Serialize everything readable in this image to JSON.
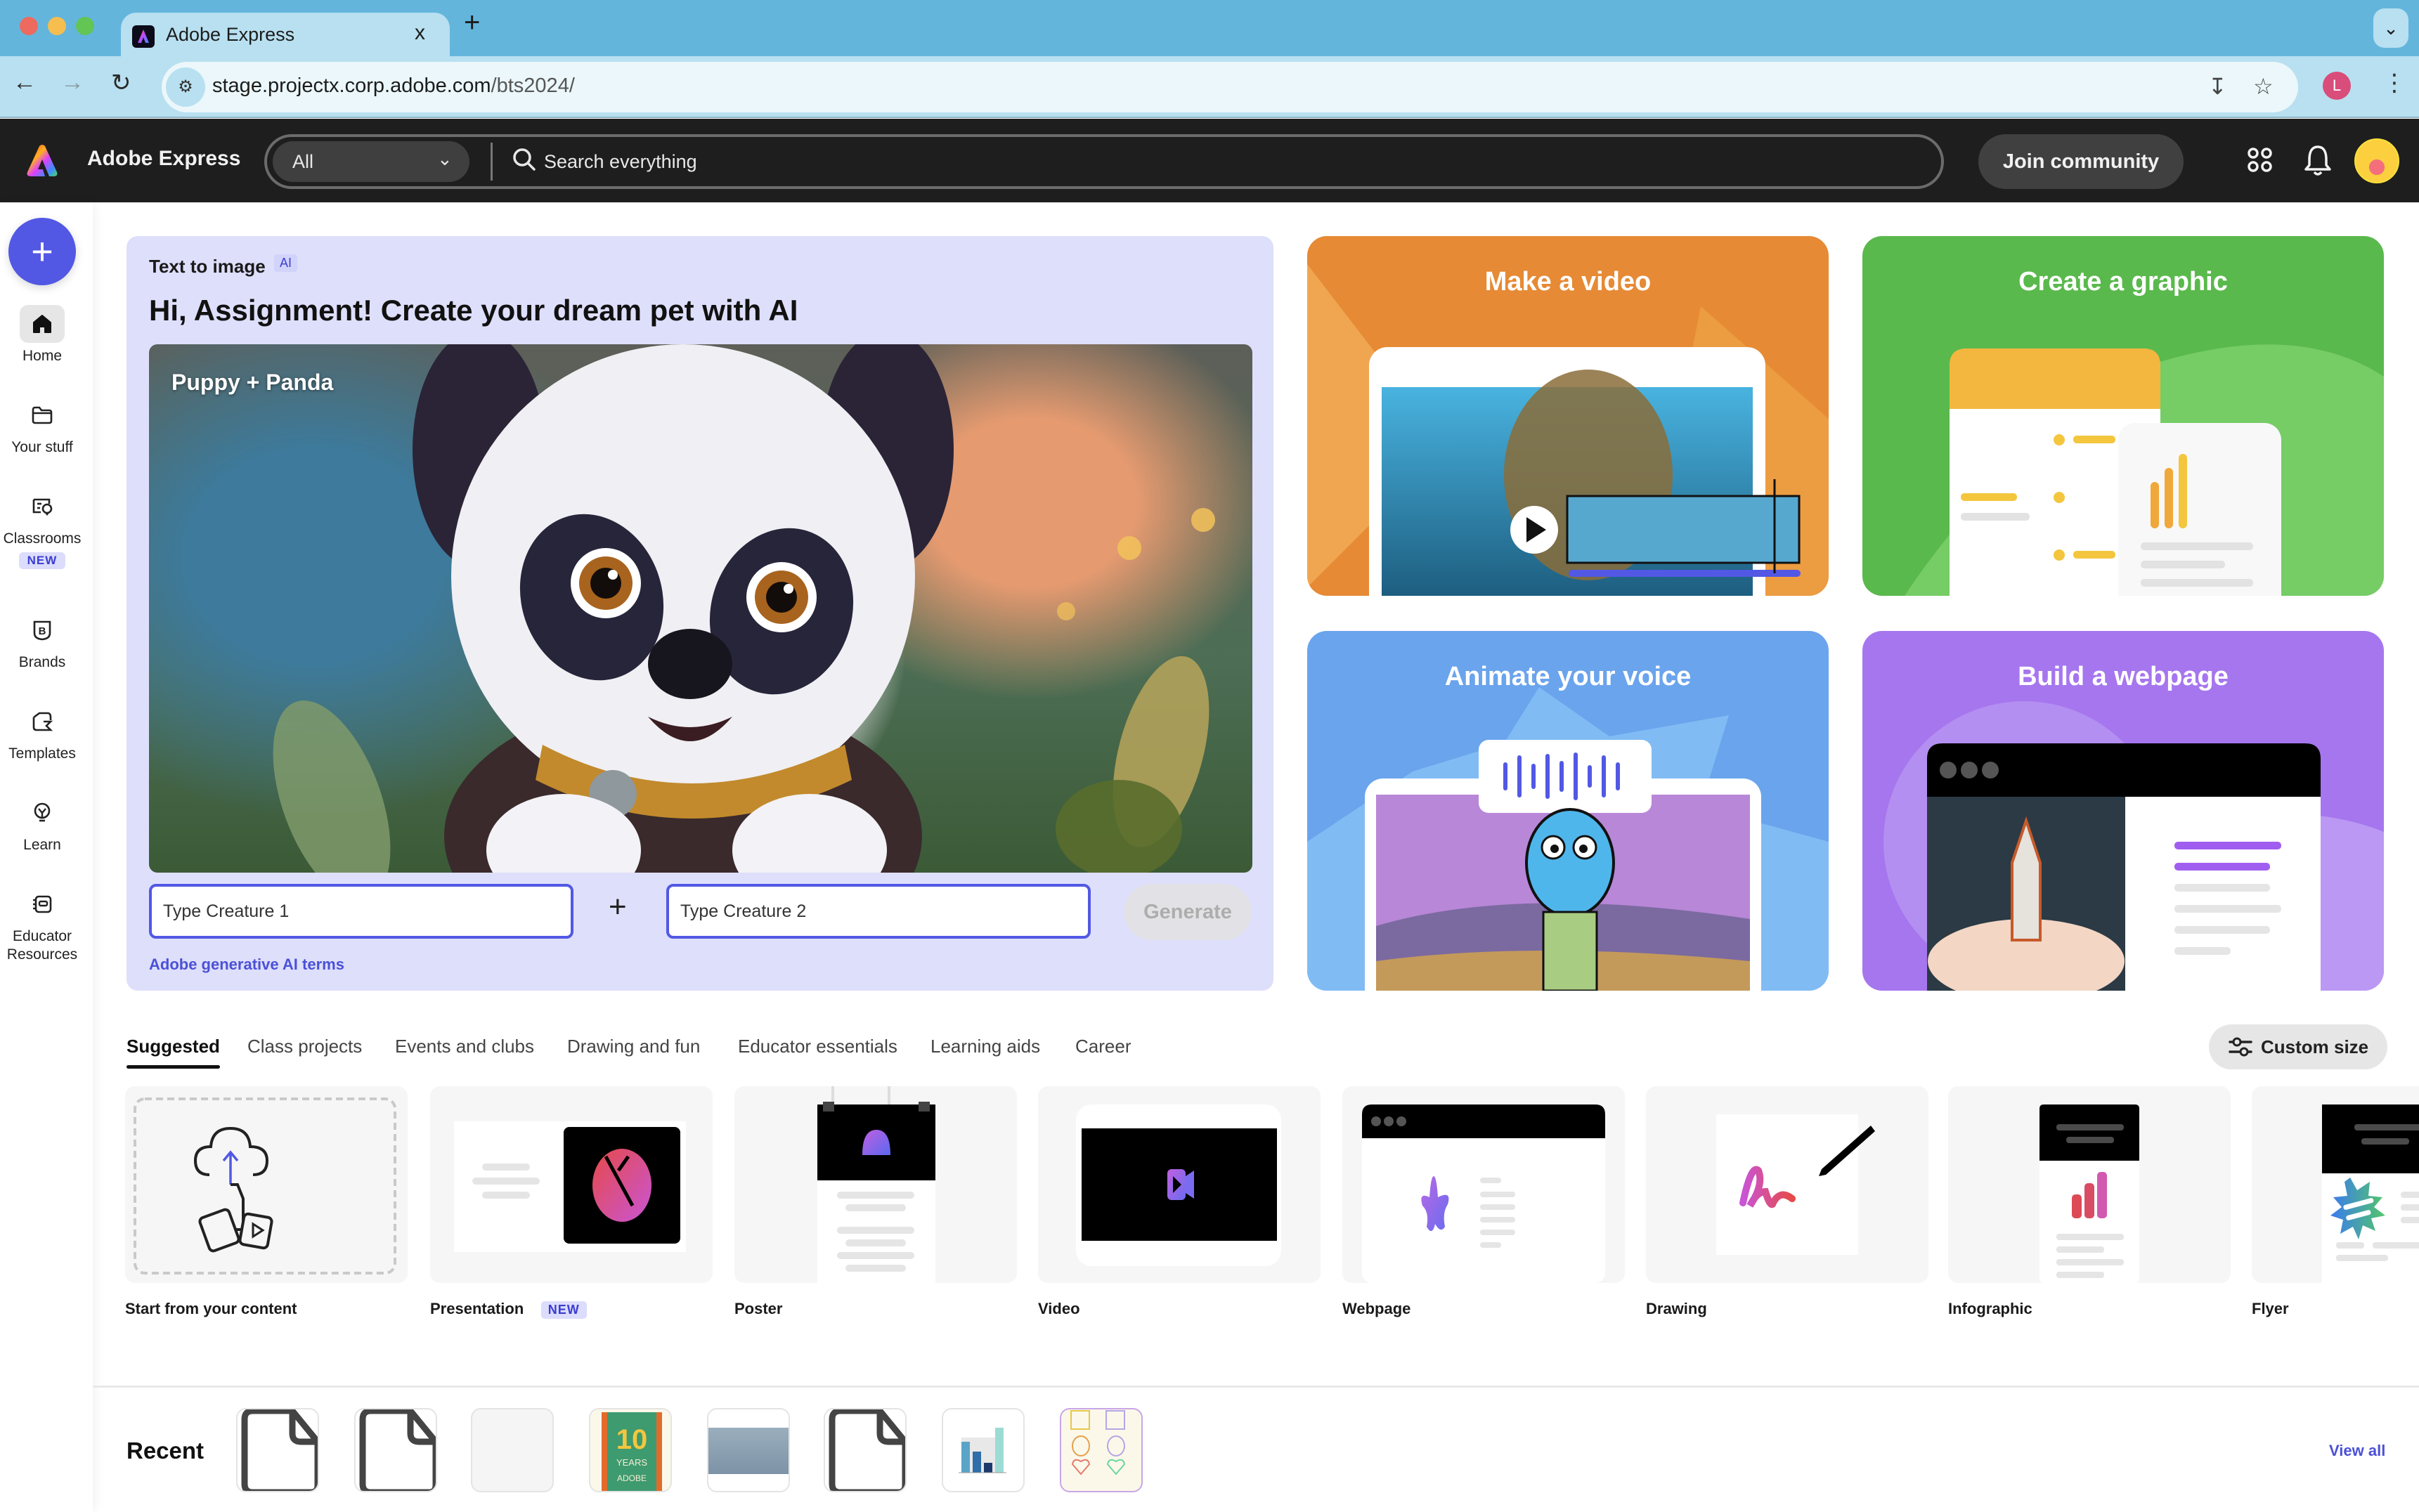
{
  "browser": {
    "tab_title": "Adobe Express",
    "tab_close": "x",
    "new_tab": "+",
    "url_host": "stage.projectx.corp.adobe.com",
    "url_path": "/bts2024/",
    "profile_initial": "L"
  },
  "header": {
    "app_name": "Adobe Express",
    "search_scope": "All",
    "search_placeholder": "Search everything",
    "join_label": "Join community"
  },
  "sidebar": {
    "create_label": "+",
    "items": [
      {
        "label": "Home",
        "icon": "home-icon",
        "active": true
      },
      {
        "label": "Your stuff",
        "icon": "folder-icon"
      },
      {
        "label": "Classrooms",
        "icon": "classroom-icon",
        "badge": "NEW"
      },
      {
        "label": "Brands",
        "icon": "brand-icon"
      },
      {
        "label": "Templates",
        "icon": "templates-icon"
      },
      {
        "label": "Learn",
        "icon": "lightbulb-icon"
      },
      {
        "label": "Educator Resources",
        "icon": "educator-resources-icon"
      }
    ]
  },
  "hero": {
    "eyebrow": "Text to image",
    "ai_badge": "AI",
    "title": "Hi, Assignment! Create your dream pet with AI",
    "image_caption": "Puppy + Panda",
    "creature1_placeholder": "Type Creature 1",
    "plus": "+",
    "creature2_placeholder": "Type Creature 2",
    "generate_label": "Generate",
    "terms_link": "Adobe generative AI terms"
  },
  "quick_actions": [
    {
      "title": "Make a video",
      "color": "#e68a35"
    },
    {
      "title": "Create a graphic",
      "color": "#5ab94c"
    },
    {
      "title": "Animate your voice",
      "color": "#6aa4ec"
    },
    {
      "title": "Build a webpage",
      "color": "#a676ee"
    }
  ],
  "category_tabs": [
    {
      "label": "Suggested",
      "active": true
    },
    {
      "label": "Class projects"
    },
    {
      "label": "Events and clubs"
    },
    {
      "label": "Drawing and fun"
    },
    {
      "label": "Educator essentials"
    },
    {
      "label": "Learning aids"
    },
    {
      "label": "Career"
    }
  ],
  "custom_size_label": "Custom size",
  "templates": [
    {
      "label": "Start from your content"
    },
    {
      "label": "Presentation",
      "badge": "NEW"
    },
    {
      "label": "Poster"
    },
    {
      "label": "Video"
    },
    {
      "label": "Webpage"
    },
    {
      "label": "Drawing"
    },
    {
      "label": "Infographic"
    },
    {
      "label": "Flyer"
    }
  ],
  "recent": {
    "label": "Recent",
    "view_all": "View all",
    "items": [
      {
        "kind": "blank-doc"
      },
      {
        "kind": "blank-doc"
      },
      {
        "kind": "empty"
      },
      {
        "kind": "10-years-adobe-poster"
      },
      {
        "kind": "ocean-photo"
      },
      {
        "kind": "blank-doc"
      },
      {
        "kind": "bar-chart"
      },
      {
        "kind": "shapes-worksheet"
      }
    ]
  },
  "colors": {
    "accent": "#5258e4",
    "header_bg": "#1e1e1e",
    "hero_bg": "#dedffb",
    "browser_tabbar": "#64b5dc",
    "browser_toolbar": "#b8e0f0"
  }
}
